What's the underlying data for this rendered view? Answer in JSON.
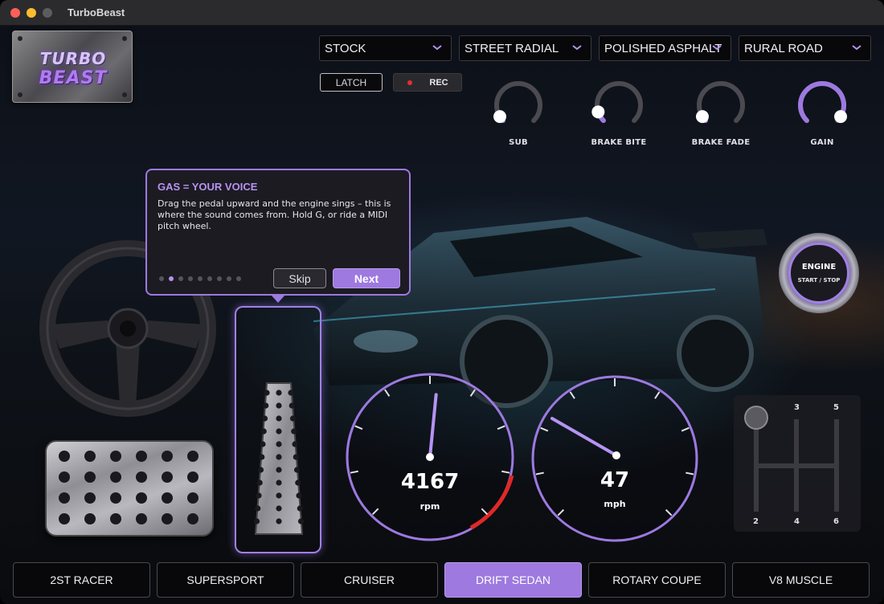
{
  "window": {
    "title": "TurboBeast"
  },
  "logo": {
    "line1": "TURBO",
    "line2": "BEAST"
  },
  "dropdowns": [
    {
      "id": "tune",
      "value": "STOCK"
    },
    {
      "id": "tire",
      "value": "STREET RADIAL"
    },
    {
      "id": "surface",
      "value": "POLISHED ASPHALT"
    },
    {
      "id": "environment",
      "value": "RURAL ROAD"
    }
  ],
  "buttons": {
    "latch": "LATCH",
    "rec": "REC"
  },
  "knobs": [
    {
      "label": "SUB",
      "level": 0.05
    },
    {
      "label": "BRAKE BITE",
      "level": 0.1
    },
    {
      "label": "BRAKE FADE",
      "level": 0.05
    },
    {
      "label": "GAIN",
      "level": 0.95
    }
  ],
  "tooltip": {
    "title": "GAS = YOUR VOICE",
    "body": "Drag the pedal upward and the engine sings – this is where the sound comes from. Hold G, or ride a MIDI pitch wheel.",
    "step": 2,
    "steps": 9,
    "skip": "Skip",
    "next": "Next"
  },
  "gauges": {
    "rpm": {
      "value": "4167",
      "unit": "rpm",
      "max": 8000
    },
    "speed": {
      "value": "47",
      "unit": "mph"
    }
  },
  "engine": {
    "label": "ENGINE",
    "sublabel": "START / STOP"
  },
  "shifter": {
    "gears": [
      "3",
      "5",
      "2",
      "4",
      "6"
    ]
  },
  "presets": [
    {
      "label": "2ST RACER",
      "active": false
    },
    {
      "label": "SUPERSPORT",
      "active": false
    },
    {
      "label": "CRUISER",
      "active": false
    },
    {
      "label": "DRIFT SEDAN",
      "active": true
    },
    {
      "label": "ROTARY COUPE",
      "active": false
    },
    {
      "label": "V8 MUSCLE",
      "active": false
    }
  ],
  "colors": {
    "accent": "#9d79e0",
    "redline": "#e02828",
    "background": "#0c0f16"
  },
  "icons": [
    "chevron-down-icon",
    "steering-wheel-icon",
    "brake-pedal-icon",
    "gas-pedal-icon",
    "gear-shifter-icon"
  ]
}
